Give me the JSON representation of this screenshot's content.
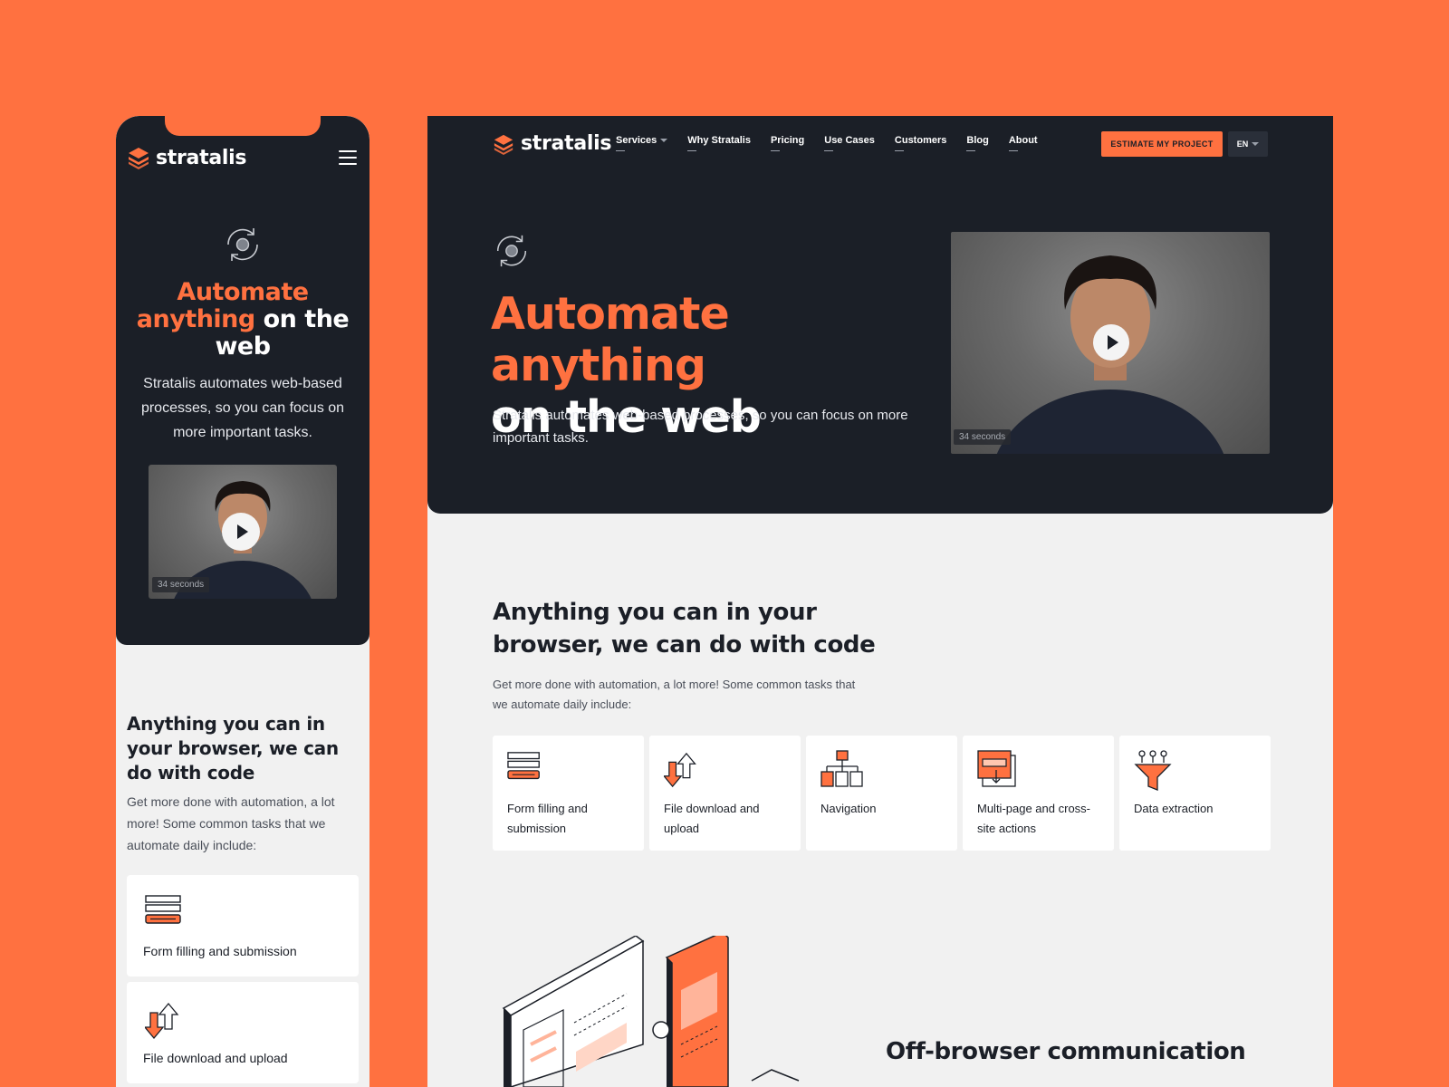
{
  "brand": {
    "name": "stratalis",
    "accent": "#FF7140",
    "dark": "#1B1F27"
  },
  "nav": {
    "items": [
      "Services",
      "Why Stratalis",
      "Pricing",
      "Use Cases",
      "Customers",
      "Blog",
      "About"
    ],
    "cta": "ESTIMATE MY PROJECT",
    "lang": "EN"
  },
  "hero": {
    "title_highlight": "Automate anything",
    "title_rest": "on the web",
    "mobile_title_line1": "Automate",
    "mobile_title_line2_hl": "anything",
    "mobile_title_line2_rest": " on the",
    "mobile_title_line3": "web",
    "subtitle": "Stratalis automates web-based processes, so you can focus on more important tasks.",
    "video_duration": "34 seconds"
  },
  "tasks": {
    "heading": "Anything you can in your browser, we can do with code",
    "mobile_heading": "Anything you can in your browser, we can do with code",
    "intro": "Get more done with automation, a lot more! Some common tasks that we automate daily include:",
    "items": [
      {
        "label": "Form filling and submission",
        "icon": "form-icon"
      },
      {
        "label": "File download and upload",
        "icon": "transfer-icon"
      },
      {
        "label": "Navigation",
        "icon": "sitemap-icon"
      },
      {
        "label": "Multi-page and cross-site actions",
        "icon": "multipage-icon"
      },
      {
        "label": "Data extraction",
        "icon": "funnel-icon"
      }
    ]
  },
  "offbrowser": {
    "heading": "Off-browser communication"
  }
}
